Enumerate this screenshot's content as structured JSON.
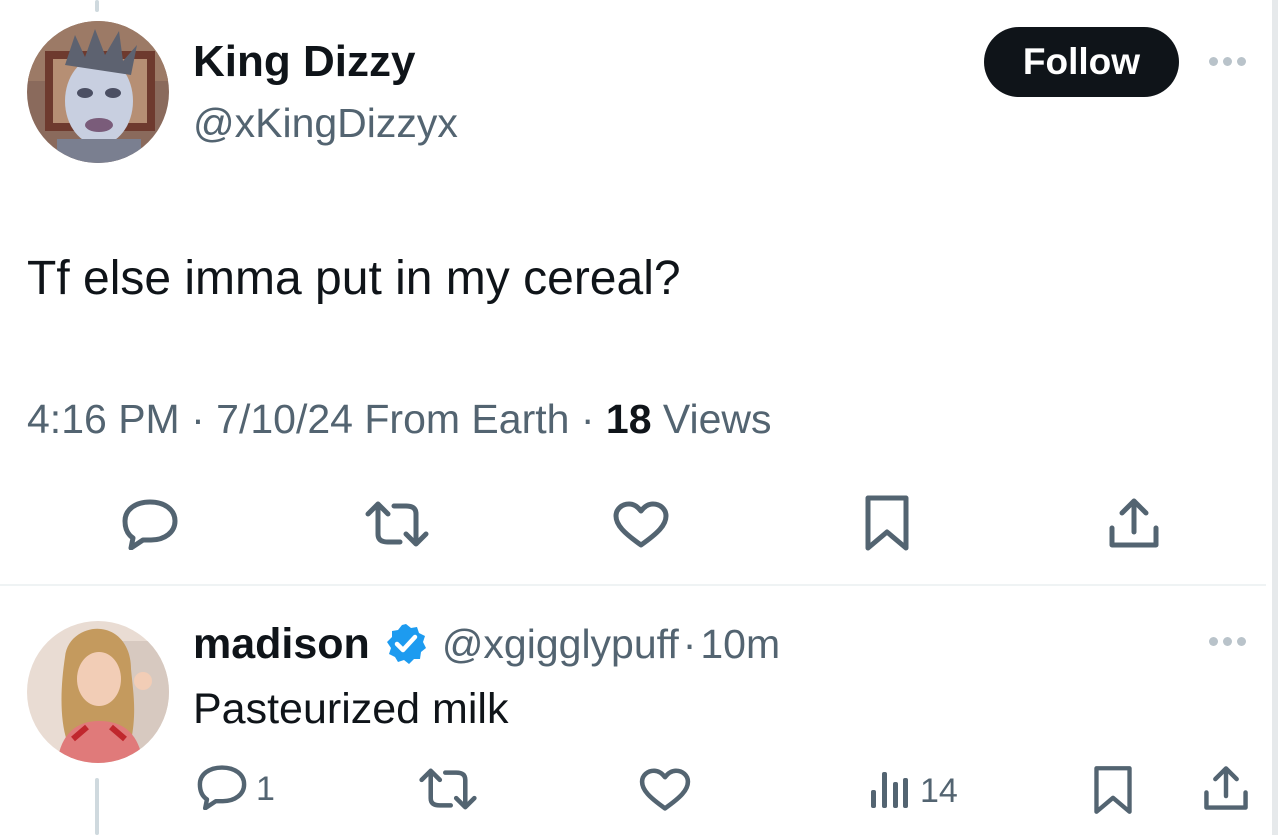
{
  "tweet": {
    "author_name": "King Dizzy",
    "author_handle": "@xKingDizzyx",
    "follow_label": "Follow",
    "text": "Tf else imma put in my cereal?",
    "time": "4:16 PM",
    "date": "7/10/24",
    "source": "From Earth",
    "views_count": "18",
    "views_label": "Views",
    "separator": "·",
    "actions": [
      "reply-icon",
      "retweet-icon",
      "like-icon",
      "bookmark-icon",
      "share-icon"
    ]
  },
  "reply": {
    "author_name": "madison",
    "verified": true,
    "author_handle": "@xgigglypuff",
    "separator": "·",
    "age": "10m",
    "text": "Pasteurized milk",
    "reply_count": "1",
    "views_count": "14"
  },
  "colors": {
    "text_primary": "#0f1419",
    "text_muted": "#536471",
    "follow_bg": "#0f1419",
    "verified_blue": "#1d9bf0",
    "divider": "#eff3f4"
  }
}
